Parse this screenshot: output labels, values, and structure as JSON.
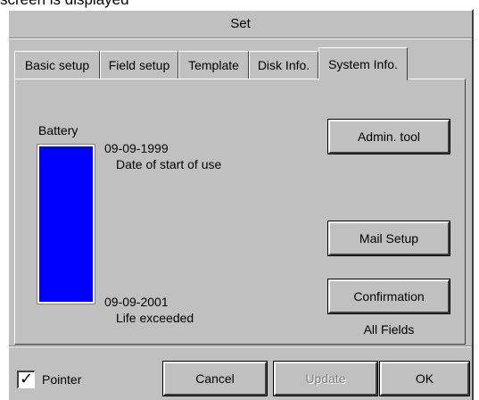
{
  "caption": "screen is displayed",
  "window": {
    "title": "Set"
  },
  "tabs": [
    {
      "label": "Basic setup",
      "active": false
    },
    {
      "label": "Field setup",
      "active": false
    },
    {
      "label": "Template",
      "active": false
    },
    {
      "label": "Disk Info.",
      "active": false
    },
    {
      "label": "System Info.",
      "active": true
    }
  ],
  "battery": {
    "label": "Battery",
    "start_date": "09-09-1999",
    "start_caption": "Date of start of use",
    "end_date": "09-09-2001",
    "end_caption": "Life exceeded",
    "bar_color": "#0000ff"
  },
  "buttons": {
    "admin_tool": "Admin. tool",
    "mail_setup": "Mail Setup",
    "confirmation": "Confirmation",
    "confirmation_note": "All Fields"
  },
  "footer": {
    "pointer_label": "Pointer",
    "pointer_checked": true,
    "check_glyph": "✓",
    "cancel": "Cancel",
    "update": "Update",
    "ok": "OK"
  }
}
